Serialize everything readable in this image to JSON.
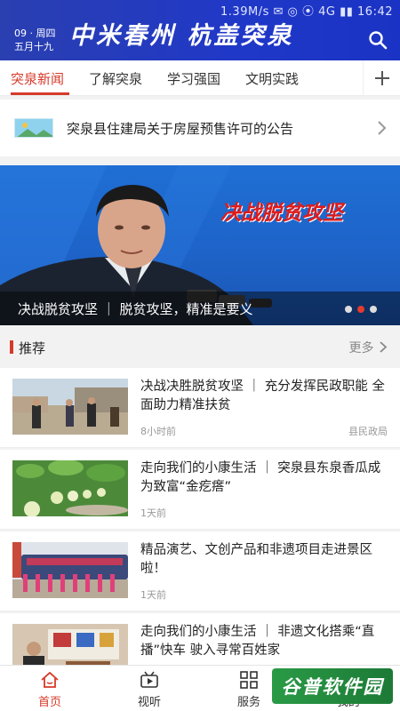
{
  "statusbar": {
    "text": "1.39M/s  ✉ ◎ ⦿  4G  ▮▮ 16:42"
  },
  "header": {
    "date_line1": "09 · 周四",
    "date_line2": "五月十九",
    "brand": "中米春州  杭盖突泉"
  },
  "tabs": [
    {
      "label": "突泉新闻",
      "active": true
    },
    {
      "label": "了解突泉",
      "active": false
    },
    {
      "label": "学习强国",
      "active": false
    },
    {
      "label": "文明实践",
      "active": false
    }
  ],
  "notice": {
    "text": "突泉县住建局关于房屋预售许可的公告"
  },
  "banner": {
    "slogan": "决战脱贫攻坚",
    "caption": "决战脱贫攻坚 ｜ 脱贫攻坚，精准是要义",
    "dots": 3,
    "active_dot": 1
  },
  "recommend": {
    "title": "推荐",
    "more": "更多"
  },
  "news": [
    {
      "title": "决战决胜脱贫攻坚 ｜ 充分发挥民政职能 全面助力精准扶贫",
      "time": "8小时前",
      "source": "县民政局"
    },
    {
      "title": "走向我们的小康生活 ｜ 突泉县东泉香瓜成为致富“金疙瘩”",
      "time": "1天前",
      "source": ""
    },
    {
      "title": "精品演艺、文创产品和非遗项目走进景区啦！",
      "time": "1天前",
      "source": ""
    },
    {
      "title": "走向我们的小康生活 ｜ 非遗文化搭乘“直播”快车 驶入寻常百姓家",
      "time": "",
      "source": ""
    }
  ],
  "bottom_nav": [
    {
      "label": "首页",
      "icon": "home-icon",
      "active": true
    },
    {
      "label": "视听",
      "icon": "video-icon",
      "active": false
    },
    {
      "label": "服务",
      "icon": "grid-icon",
      "active": false
    },
    {
      "label": "我的",
      "icon": "user-icon",
      "active": false
    }
  ],
  "watermark": {
    "text": "谷普软件园"
  },
  "colors": {
    "header": "#2038c8",
    "accent": "#d63a2a"
  }
}
